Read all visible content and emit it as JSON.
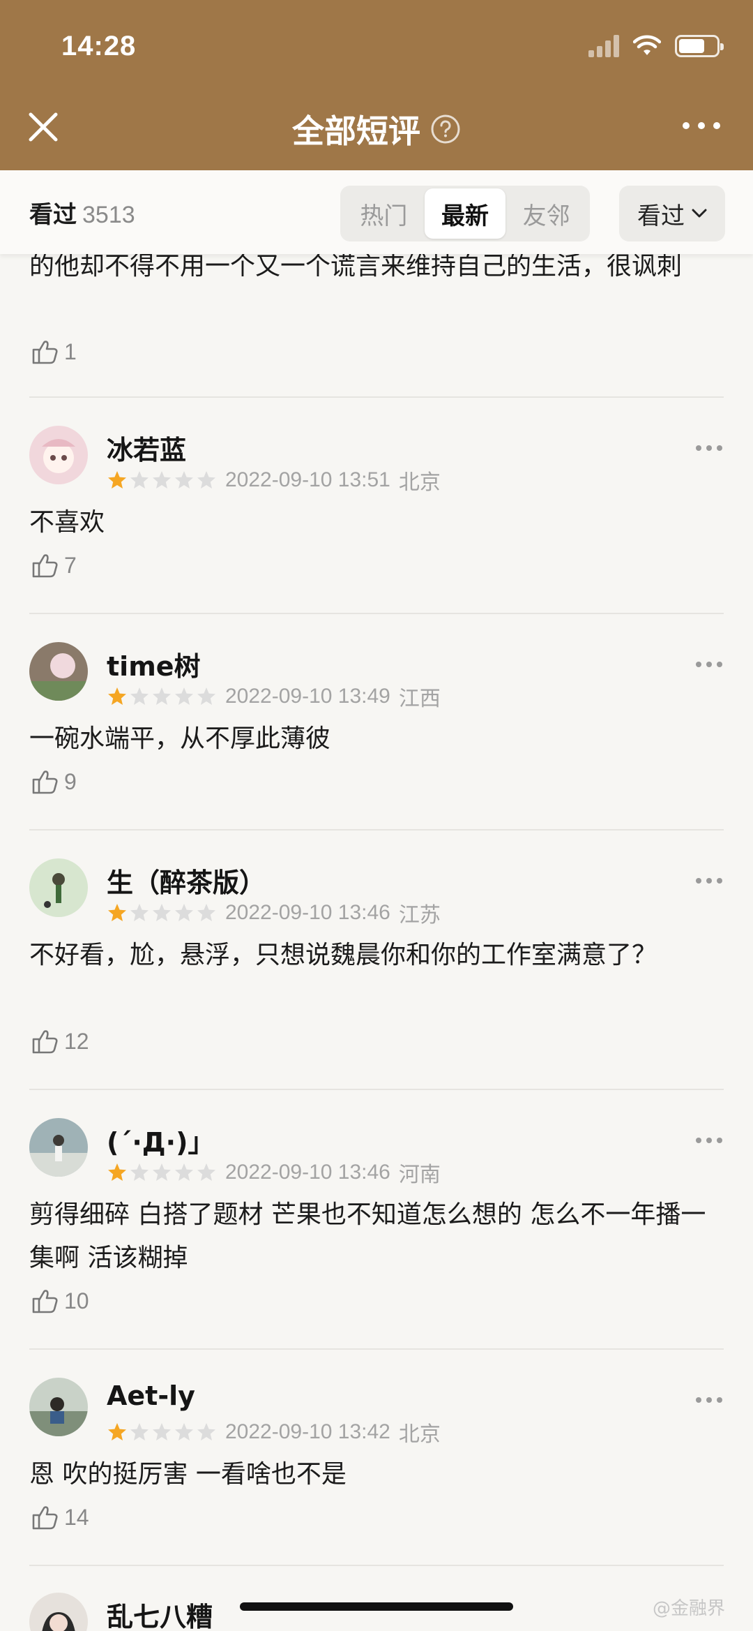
{
  "status": {
    "time": "14:28"
  },
  "header": {
    "title": "全部短评"
  },
  "filter": {
    "watched_label": "看过",
    "watched_count": "3513",
    "tabs": [
      {
        "label": "热门",
        "active": false
      },
      {
        "label": "最新",
        "active": true
      },
      {
        "label": "友邻",
        "active": false
      }
    ],
    "dropdown_label": "看过"
  },
  "partial_comment": {
    "text": "的他却不得不用一个又一个谎言来维持自己的生活，很讽刺",
    "likes": "1"
  },
  "comments": [
    {
      "name": "冰若蓝",
      "rating": 1,
      "datetime": "2022-09-10 13:51",
      "location": "北京",
      "text": "不喜欢",
      "likes": "7",
      "avatar_color": "#f1d7dc"
    },
    {
      "name": "time树",
      "rating": 1,
      "datetime": "2022-09-10 13:49",
      "location": "江西",
      "text": "一碗水端平，从不厚此薄彼",
      "likes": "9",
      "avatar_color": "#8a7a6a"
    },
    {
      "name": "生（醉茶版）",
      "rating": 1,
      "datetime": "2022-09-10 13:46",
      "location": "江苏",
      "text": "不好看，尬，悬浮，只想说魏晨你和你的工作室满意了？",
      "likes": "12",
      "avatar_color": "#d7e6cf"
    },
    {
      "name": "(´·Д·)」",
      "rating": 1,
      "datetime": "2022-09-10 13:46",
      "location": "河南",
      "text": "剪得细碎 白搭了题材 芒果也不知道怎么想的 怎么不一年播一集啊 活该糊掉",
      "likes": "10",
      "avatar_color": "#9fb2b6"
    },
    {
      "name": "Aet-ly",
      "rating": 1,
      "datetime": "2022-09-10 13:42",
      "location": "北京",
      "text": "恩 吹的挺厉害 一看啥也不是",
      "likes": "14",
      "avatar_color": "#7f8f7a"
    },
    {
      "name": "乱七八糟",
      "rating": 0,
      "datetime": "",
      "location": "",
      "text": "",
      "likes": "",
      "avatar_color": "#3a3a3a"
    }
  ],
  "watermark": "@金融界"
}
